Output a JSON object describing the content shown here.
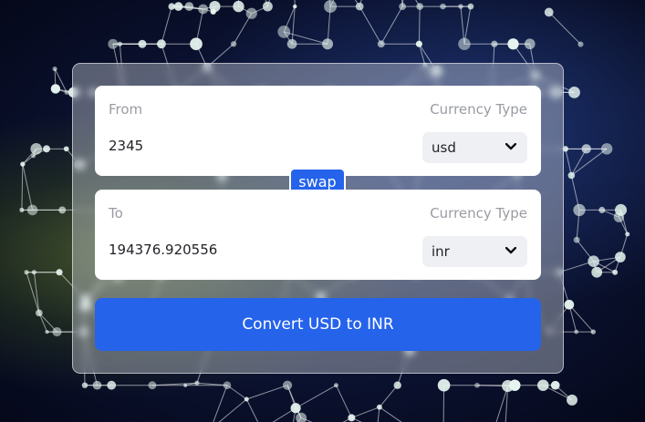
{
  "colors": {
    "accent": "#2563eb",
    "card": "#ffffff",
    "label": "#9a9ca3",
    "select_bg": "#eef0f3"
  },
  "background": {
    "description_icon": "network-globe"
  },
  "from": {
    "label": "From",
    "type_label": "Currency Type",
    "amount": "2345",
    "currency": "usd"
  },
  "swap_label": "swap",
  "to": {
    "label": "To",
    "type_label": "Currency Type",
    "amount": "194376.920556",
    "currency": "inr"
  },
  "convert_label": "Convert USD to INR",
  "icons": {
    "select_arrow": "chevron-down-icon"
  }
}
